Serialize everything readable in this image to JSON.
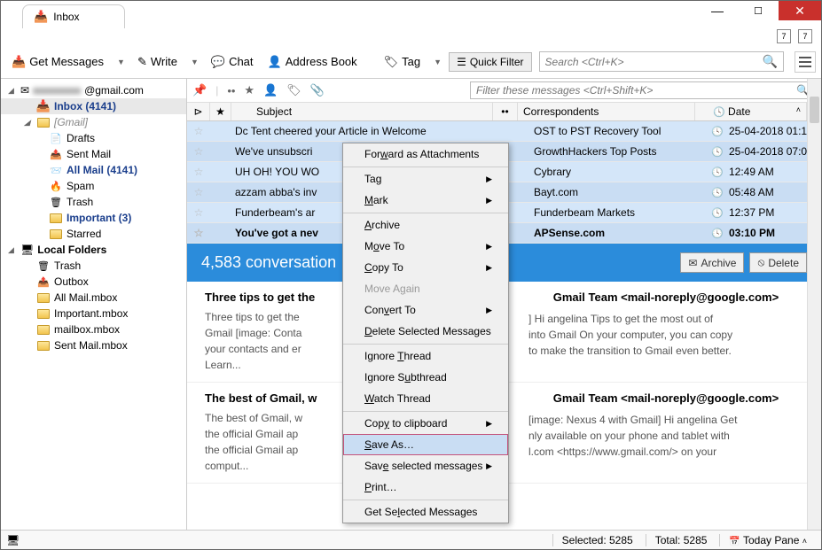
{
  "tab": {
    "title": "Inbox"
  },
  "toolbar": {
    "get_messages": "Get Messages",
    "write": "Write",
    "chat": "Chat",
    "address_book": "Address Book",
    "tag": "Tag",
    "quick_filter": "Quick Filter",
    "search_placeholder": "Search <Ctrl+K>"
  },
  "sidebar": {
    "account": "@gmail.com",
    "items": [
      {
        "label": "Inbox (4141)",
        "icon": "inbox",
        "sel": true,
        "level": 1,
        "blue": true
      },
      {
        "label": "[Gmail]",
        "icon": "folder",
        "level": 1,
        "italic": true
      },
      {
        "label": "Drafts",
        "icon": "drafts",
        "level": 2
      },
      {
        "label": "Sent Mail",
        "icon": "sent",
        "level": 2
      },
      {
        "label": "All Mail (4141)",
        "icon": "allmail",
        "level": 2,
        "blue": true
      },
      {
        "label": "Spam",
        "icon": "spam",
        "level": 2
      },
      {
        "label": "Trash",
        "icon": "trash",
        "level": 2
      },
      {
        "label": "Important (3)",
        "icon": "important",
        "level": 2,
        "blue": true
      },
      {
        "label": "Starred",
        "icon": "folder",
        "level": 2
      }
    ],
    "local_label": "Local Folders",
    "local": [
      {
        "label": "Trash",
        "icon": "trash"
      },
      {
        "label": "Outbox",
        "icon": "outbox"
      },
      {
        "label": "All Mail.mbox",
        "icon": "folder"
      },
      {
        "label": "Important.mbox",
        "icon": "folder"
      },
      {
        "label": "mailbox.mbox",
        "icon": "folder"
      },
      {
        "label": "Sent Mail.mbox",
        "icon": "folder"
      }
    ]
  },
  "filter_placeholder": "Filter these messages <Ctrl+Shift+K>",
  "columns": {
    "subject": "Subject",
    "correspondents": "Correspondents",
    "date": "Date"
  },
  "messages": [
    {
      "subject": "Dc Tent cheered your Article in Welcome",
      "corr": "OST to PST Recovery Tool",
      "date": "25-04-2018 01:1…"
    },
    {
      "subject": "We've unsubscri",
      "corr": "GrowthHackers Top Posts",
      "date": "25-04-2018 07:0…"
    },
    {
      "subject": "UH OH! YOU WO",
      "corr": "Cybrary",
      "date": "12:49 AM"
    },
    {
      "subject": "azzam abba's inv",
      "corr": "Bayt.com",
      "date": "05:48 AM"
    },
    {
      "subject": "Funderbeam's ar",
      "corr": "Funderbeam Markets",
      "date": "12:37 PM"
    },
    {
      "subject": "You've got a nev",
      "corr": "APSense.com",
      "date": "03:10 PM",
      "bold": true
    }
  ],
  "conv_header": "4,583 conversation",
  "conv_actions": {
    "archive": "Archive",
    "delete": "Delete"
  },
  "preview1": {
    "title": "Three tips to get the",
    "body": "Three tips to get the\nGmail [image: Conta\nyour contacts and er\nLearn...",
    "from": "Gmail Team <mail-noreply@google.com>",
    "body_right": "] Hi angelina Tips to get the most out of\ninto Gmail On your computer, you can copy\nto make the transition to Gmail even better."
  },
  "preview2": {
    "title": "The best of Gmail, w",
    "body": "The best of Gmail, w\nthe official Gmail ap\nthe official Gmail ap\ncomput...",
    "from": "Gmail Team <mail-noreply@google.com>",
    "body_right": "[image: Nexus 4 with Gmail] Hi angelina Get\nnly available on your phone and tablet with\nl.com <https://www.gmail.com/> on your"
  },
  "context_menu": [
    {
      "label": "Forward as Attachments"
    },
    {
      "label": "Tag",
      "sub": true,
      "sep": true
    },
    {
      "label": "Mark",
      "sub": true
    },
    {
      "label": "Archive",
      "sep": true
    },
    {
      "label": "Move To",
      "sub": true
    },
    {
      "label": "Copy To",
      "sub": true
    },
    {
      "label": "Move Again",
      "disabled": true
    },
    {
      "label": "Convert To",
      "sub": true
    },
    {
      "label": "Delete Selected Messages"
    },
    {
      "label": "Ignore Thread",
      "sep": true
    },
    {
      "label": "Ignore Subthread"
    },
    {
      "label": "Watch Thread"
    },
    {
      "label": "Copy to clipboard",
      "sub": true,
      "sep": true
    },
    {
      "label": "Save As…",
      "highlighted": true
    },
    {
      "label": "Save selected messages",
      "sub": true
    },
    {
      "label": "Print…"
    },
    {
      "label": "Get Selected Messages",
      "sep": true
    }
  ],
  "status": {
    "selected": "Selected: 5285",
    "total": "Total: 5285",
    "today": "Today Pane"
  }
}
